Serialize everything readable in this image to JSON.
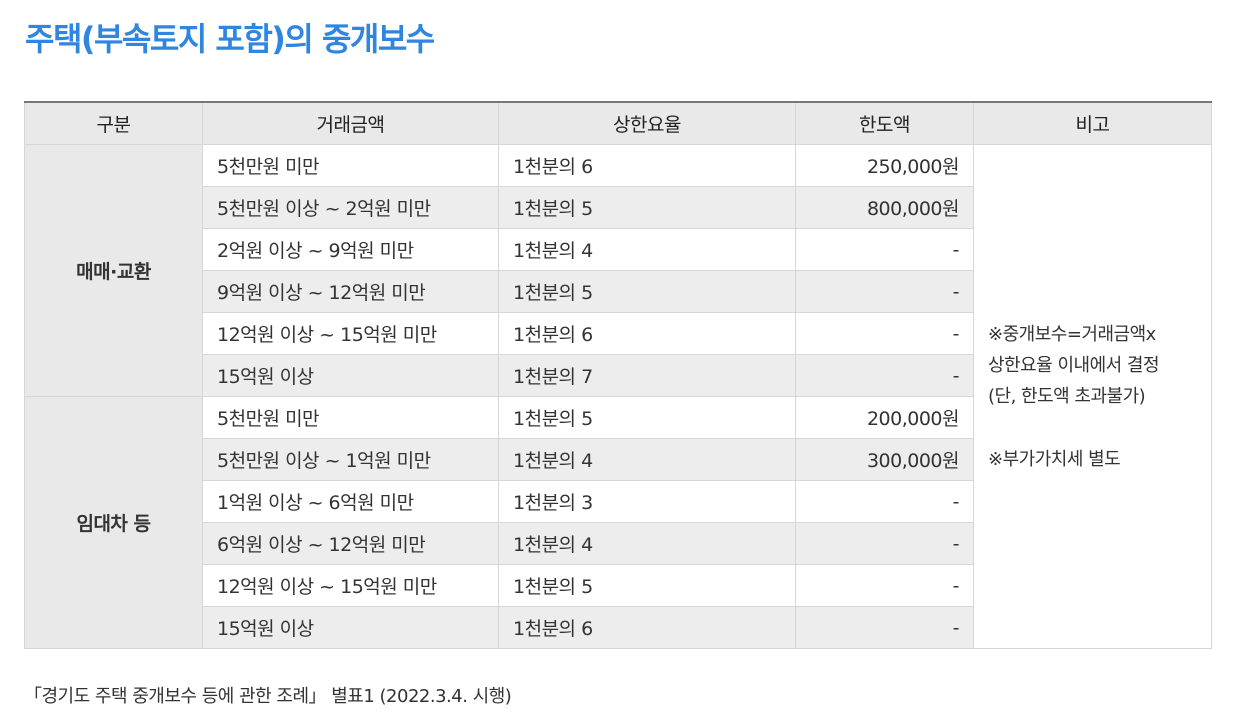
{
  "page": {
    "title": "주택(부속토지 포함)의 중개보수"
  },
  "table": {
    "headers": [
      "구분",
      "거래금액",
      "상한요율",
      "한도액",
      "비고"
    ],
    "groups": [
      {
        "label": "매매·교환",
        "rows": [
          {
            "amount": "5천만원 미만",
            "rate": "1천분의 6",
            "limit": "250,000원"
          },
          {
            "amount": "5천만원 이상 ~ 2억원 미만",
            "rate": "1천분의 5",
            "limit": "800,000원"
          },
          {
            "amount": "2억원 이상 ~ 9억원 미만",
            "rate": "1천분의 4",
            "limit": "-"
          },
          {
            "amount": "9억원 이상 ~ 12억원 미만",
            "rate": "1천분의 5",
            "limit": "-"
          },
          {
            "amount": "12억원 이상 ~ 15억원 미만",
            "rate": "1천분의 6",
            "limit": "-"
          },
          {
            "amount": "15억원 이상",
            "rate": "1천분의 7",
            "limit": "-"
          }
        ]
      },
      {
        "label": "임대차 등",
        "rows": [
          {
            "amount": "5천만원 미만",
            "rate": "1천분의 5",
            "limit": "200,000원"
          },
          {
            "amount": "5천만원 이상 ~ 1억원 미만",
            "rate": "1천분의 4",
            "limit": "300,000원"
          },
          {
            "amount": "1억원 이상 ~ 6억원 미만",
            "rate": "1천분의 3",
            "limit": "-"
          },
          {
            "amount": "6억원 이상 ~ 12억원 미만",
            "rate": "1천분의 4",
            "limit": "-"
          },
          {
            "amount": "12억원 이상 ~ 15억원 미만",
            "rate": "1천분의 5",
            "limit": "-"
          },
          {
            "amount": "15억원 이상",
            "rate": "1천분의 6",
            "limit": "-"
          }
        ]
      }
    ],
    "note": {
      "line1": "※중개보수=거래금액x",
      "line2": "상한요율 이내에서 결정",
      "line3": "(단, 한도액 초과불가)",
      "line4": "※부가가치세 별도"
    }
  },
  "footer": {
    "source": "「경기도 주택 중개보수 등에 관한 조례」 별표1 (2022.3.4. 시행)"
  },
  "colors": {
    "title": "#2f86e0",
    "header_bg": "#e9e9e9",
    "alt_row_bg": "#ededed",
    "border": "#d6d6d6"
  }
}
